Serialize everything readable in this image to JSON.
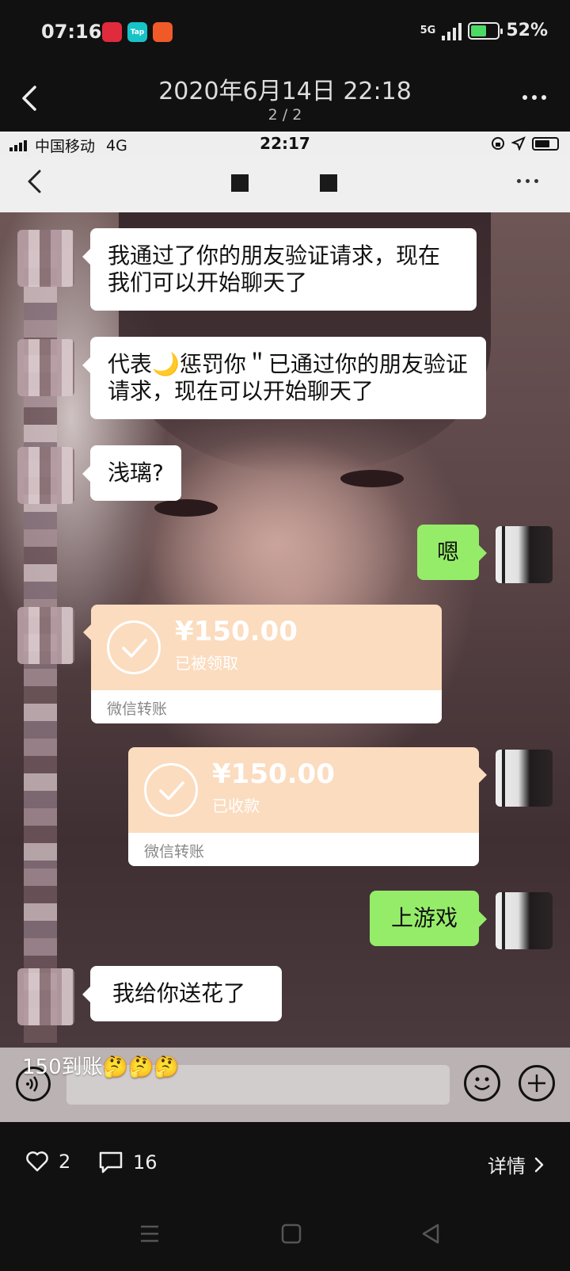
{
  "status_bar": {
    "time": "07:16",
    "app_icons": [
      {
        "name": "red-app-icon",
        "color": "#e02b3c",
        "label": ""
      },
      {
        "name": "taptap-icon",
        "color": "#18c3c8",
        "label": "Tap"
      },
      {
        "name": "orange-app-icon",
        "color": "#f05a28",
        "label": ""
      }
    ],
    "network": "5G",
    "battery": "52%"
  },
  "viewer": {
    "title": "2020年6月14日 22:18",
    "counter": "2 / 2"
  },
  "screenshot": {
    "inner_status": {
      "carrier": "中国移动",
      "network": "4G",
      "time": "22:17"
    },
    "messages": [
      {
        "side": "left",
        "text": "我通过了你的朋友验证请求，现在我们可以开始聊天了"
      },
      {
        "side": "left",
        "text_before": "代表",
        "emoji": "🌙",
        "text_after": "惩罚你＂已通过你的朋友验证请求，现在可以开始聊天了"
      },
      {
        "side": "left",
        "text": "浅璃?"
      },
      {
        "side": "right",
        "text": "嗯"
      },
      {
        "side": "left",
        "type": "transfer",
        "amount": "¥150.00",
        "status": "已被领取",
        "footer": "微信转账"
      },
      {
        "side": "right",
        "type": "transfer",
        "amount": "¥150.00",
        "status": "已收款",
        "footer": "微信转账"
      },
      {
        "side": "right",
        "text": "上游戏"
      },
      {
        "side": "left",
        "text": "我给你送花了"
      }
    ]
  },
  "caption": "150到账🤔🤔🤔",
  "actions": {
    "likes": "2",
    "comments": "16",
    "details": "详情"
  },
  "colors": {
    "green_bubble": "#95ec69",
    "transfer_bg": "#fbdcbf",
    "accent_battery": "#4cd964"
  }
}
